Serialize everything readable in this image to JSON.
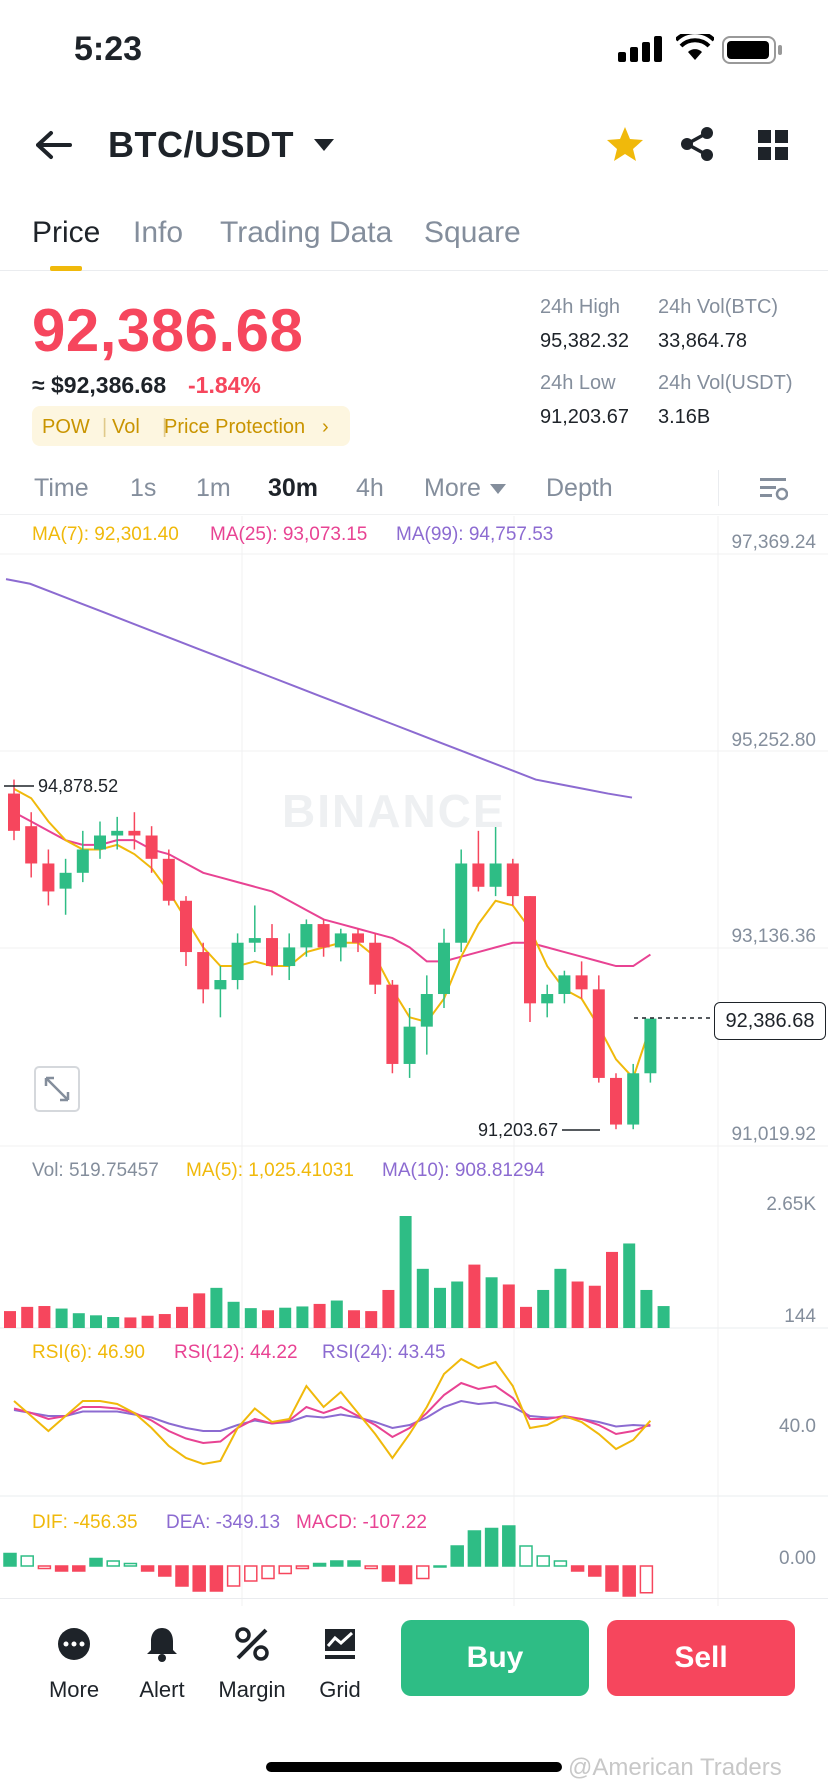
{
  "status_bar": {
    "time": "5:23"
  },
  "header": {
    "pair": "BTC/USDT",
    "icons": [
      "back-arrow-icon",
      "caret-down-icon",
      "star-icon",
      "share-icon",
      "grid-icon"
    ]
  },
  "tabs": [
    {
      "label": "Price",
      "active": true
    },
    {
      "label": "Info",
      "active": false
    },
    {
      "label": "Trading Data",
      "active": false
    },
    {
      "label": "Square",
      "active": false
    }
  ],
  "ticker": {
    "last_price": "92,386.68",
    "usd_value": "≈ $92,386.68",
    "change_pct": "-1.84%",
    "tags": [
      "POW",
      "Vol",
      "Price Protection"
    ],
    "stats": {
      "high_label": "24h High",
      "high_value": "95,382.32",
      "vol_btc_label": "24h Vol(BTC)",
      "vol_btc_value": "33,864.78",
      "low_label": "24h Low",
      "low_value": "91,203.67",
      "vol_usdt_label": "24h Vol(USDT)",
      "vol_usdt_value": "3.16B"
    }
  },
  "timeframes": [
    {
      "label": "Time",
      "active": false
    },
    {
      "label": "1s",
      "active": false
    },
    {
      "label": "1m",
      "active": false
    },
    {
      "label": "30m",
      "active": true
    },
    {
      "label": "4h",
      "active": false
    },
    {
      "label": "More",
      "active": false
    },
    {
      "label": "Depth",
      "active": false
    }
  ],
  "main_chart": {
    "ma7": "MA(7): 92,301.40",
    "ma25": "MA(25): 93,073.15",
    "ma99": "MA(99): 94,757.53",
    "axis": [
      "97,369.24",
      "95,252.80",
      "93,136.36",
      "91,019.92"
    ],
    "high_marker": "94,878.52",
    "low_marker": "91,203.67",
    "current_price": "92,386.68",
    "watermark": "BINANCE"
  },
  "volume": {
    "vol": "Vol: 519.75457",
    "ma5": "MA(5): 1,025.41031",
    "ma10": "MA(10): 908.81294",
    "axis_top": "2.65K",
    "axis_bottom": "144"
  },
  "rsi": {
    "rsi6": "RSI(6): 46.90",
    "rsi12": "RSI(12): 44.22",
    "rsi24": "RSI(24): 43.45",
    "axis": "40.0"
  },
  "macd": {
    "dif": "DIF: -456.35",
    "dea": "DEA: -349.13",
    "macd": "MACD: -107.22",
    "axis": "0.00"
  },
  "bottom_bar": {
    "items": [
      {
        "label": "More",
        "icon": "more-dots-icon"
      },
      {
        "label": "Alert",
        "icon": "bell-icon"
      },
      {
        "label": "Margin",
        "icon": "margin-icon"
      },
      {
        "label": "Grid",
        "icon": "grid-chart-icon"
      }
    ],
    "buy": "Buy",
    "sell": "Sell"
  },
  "footer_watermark": "@American Traders",
  "colors": {
    "up": "#2ebd85",
    "down": "#f6465d",
    "brand": "#f0b90b",
    "ma7": "#f0b90b",
    "ma25": "#e84393",
    "ma99": "#8c6bd1"
  },
  "candles": [
    {
      "o": 94800,
      "h": 94950,
      "l": 94300,
      "c": 94400
    },
    {
      "o": 94450,
      "h": 94600,
      "l": 93900,
      "c": 94050
    },
    {
      "o": 94050,
      "h": 94200,
      "l": 93600,
      "c": 93750
    },
    {
      "o": 93780,
      "h": 94100,
      "l": 93500,
      "c": 93950
    },
    {
      "o": 93950,
      "h": 94400,
      "l": 93850,
      "c": 94200
    },
    {
      "o": 94200,
      "h": 94500,
      "l": 94100,
      "c": 94350
    },
    {
      "o": 94350,
      "h": 94550,
      "l": 94200,
      "c": 94400
    },
    {
      "o": 94400,
      "h": 94600,
      "l": 94200,
      "c": 94350
    },
    {
      "o": 94350,
      "h": 94450,
      "l": 93950,
      "c": 94100
    },
    {
      "o": 94100,
      "h": 94200,
      "l": 93600,
      "c": 93650
    },
    {
      "o": 93650,
      "h": 93700,
      "l": 92950,
      "c": 93100
    },
    {
      "o": 93100,
      "h": 93200,
      "l": 92550,
      "c": 92700
    },
    {
      "o": 92700,
      "h": 92950,
      "l": 92400,
      "c": 92800
    },
    {
      "o": 92800,
      "h": 93300,
      "l": 92700,
      "c": 93200
    },
    {
      "o": 93200,
      "h": 93600,
      "l": 93100,
      "c": 93250
    },
    {
      "o": 93250,
      "h": 93400,
      "l": 92850,
      "c": 92950
    },
    {
      "o": 92950,
      "h": 93300,
      "l": 92800,
      "c": 93150
    },
    {
      "o": 93150,
      "h": 93450,
      "l": 93050,
      "c": 93400
    },
    {
      "o": 93400,
      "h": 93450,
      "l": 93050,
      "c": 93150
    },
    {
      "o": 93150,
      "h": 93350,
      "l": 93000,
      "c": 93300
    },
    {
      "o": 93300,
      "h": 93350,
      "l": 93100,
      "c": 93200
    },
    {
      "o": 93200,
      "h": 93300,
      "l": 92650,
      "c": 92750
    },
    {
      "o": 92750,
      "h": 92800,
      "l": 91800,
      "c": 91900
    },
    {
      "o": 91900,
      "h": 92500,
      "l": 91750,
      "c": 92300
    },
    {
      "o": 92300,
      "h": 92850,
      "l": 92000,
      "c": 92650
    },
    {
      "o": 92650,
      "h": 93350,
      "l": 92500,
      "c": 93200
    },
    {
      "o": 93200,
      "h": 94200,
      "l": 93100,
      "c": 94050
    },
    {
      "o": 94050,
      "h": 94400,
      "l": 93750,
      "c": 93800
    },
    {
      "o": 93800,
      "h": 94450,
      "l": 93700,
      "c": 94050
    },
    {
      "o": 94050,
      "h": 94100,
      "l": 93600,
      "c": 93700
    },
    {
      "o": 93700,
      "h": 93700,
      "l": 92350,
      "c": 92550
    },
    {
      "o": 92550,
      "h": 92750,
      "l": 92400,
      "c": 92650
    },
    {
      "o": 92650,
      "h": 92900,
      "l": 92550,
      "c": 92850
    },
    {
      "o": 92850,
      "h": 93000,
      "l": 92600,
      "c": 92700
    },
    {
      "o": 92700,
      "h": 92850,
      "l": 91700,
      "c": 91750
    },
    {
      "o": 91750,
      "h": 91800,
      "l": 91200,
      "c": 91250
    },
    {
      "o": 91250,
      "h": 91900,
      "l": 91200,
      "c": 91800
    },
    {
      "o": 91800,
      "h": 92200,
      "l": 91700,
      "c": 92386
    }
  ],
  "volumes": [
    400,
    500,
    520,
    460,
    350,
    300,
    260,
    250,
    290,
    330,
    500,
    820,
    950,
    620,
    470,
    420,
    480,
    510,
    570,
    650,
    420,
    400,
    900,
    2650,
    1400,
    950,
    1100,
    1500,
    1200,
    1030,
    500,
    900,
    1400,
    1100,
    1000,
    1800,
    2000,
    900,
    519
  ],
  "ma7_values": [
    94850,
    94750,
    94500,
    94300,
    94200,
    94200,
    94250,
    94150,
    94000,
    93750,
    93450,
    93150,
    92950,
    92950,
    93000,
    92950,
    92950,
    93100,
    93150,
    93200,
    93200,
    93050,
    92700,
    92400,
    92350,
    92600,
    93050,
    93400,
    93650,
    93600,
    93350,
    92950,
    92700,
    92600,
    92300,
    91950,
    91750,
    92301
  ],
  "ma25_values": [
    94600,
    94500,
    94400,
    94300,
    94250,
    94250,
    94300,
    94300,
    94200,
    94150,
    94050,
    93950,
    93900,
    93850,
    93800,
    93750,
    93650,
    93550,
    93450,
    93400,
    93350,
    93300,
    93250,
    93150,
    93000,
    93000,
    93050,
    93100,
    93150,
    93200,
    93200,
    93150,
    93100,
    93050,
    93000,
    92950,
    92950,
    93073
  ],
  "ma99_values": [
    97100,
    97050,
    96950,
    96850,
    96750,
    96650,
    96550,
    96450,
    96350,
    96250,
    96150,
    96050,
    95950,
    95850,
    95750,
    95650,
    95550,
    95450,
    95350,
    95250,
    95150,
    95050,
    94950,
    94900,
    94850,
    94800,
    94757
  ],
  "rsi6_values": [
    60,
    50,
    40,
    50,
    60,
    60,
    58,
    52,
    42,
    30,
    22,
    18,
    20,
    42,
    55,
    46,
    48,
    70,
    56,
    66,
    52,
    38,
    22,
    38,
    56,
    78,
    88,
    82,
    86,
    70,
    42,
    44,
    50,
    46,
    38,
    28,
    34,
    46.9
  ],
  "rsi12_values": [
    55,
    52,
    48,
    50,
    56,
    56,
    55,
    52,
    47,
    40,
    35,
    32,
    33,
    42,
    48,
    45,
    47,
    56,
    52,
    56,
    50,
    44,
    36,
    42,
    52,
    64,
    72,
    68,
    70,
    62,
    48,
    48,
    50,
    48,
    44,
    38,
    40,
    44.2
  ],
  "rsi24_values": [
    54,
    52,
    50,
    50,
    53,
    53,
    53,
    51,
    49,
    45,
    42,
    40,
    40,
    44,
    47,
    45,
    46,
    50,
    49,
    51,
    49,
    46,
    42,
    44,
    49,
    56,
    60,
    58,
    59,
    56,
    50,
    49,
    49,
    48,
    46,
    43,
    44,
    43.45
  ],
  "macd_hist": [
    50,
    40,
    -10,
    -20,
    -20,
    30,
    20,
    10,
    -20,
    -40,
    -80,
    -100,
    -100,
    -80,
    -60,
    -50,
    -30,
    -10,
    10,
    20,
    20,
    -10,
    -60,
    -70,
    -50,
    0,
    80,
    140,
    150,
    160,
    80,
    40,
    20,
    -20,
    -40,
    -100,
    -120,
    -107
  ]
}
